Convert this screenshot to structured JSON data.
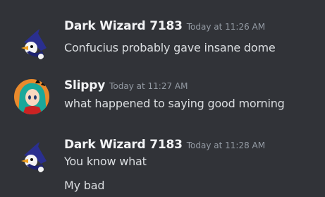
{
  "messages": [
    {
      "author": "Dark Wizard 7183",
      "timestamp": "Today at 11:26 AM",
      "avatar_icon": "wizard-avatar-icon",
      "lines": [
        "Confucius probably gave insane dome"
      ]
    },
    {
      "author": "Slippy",
      "timestamp": "Today at 11:27 AM",
      "avatar_icon": "anime-girl-avatar-icon",
      "lines": [
        "what happened to saying good morning"
      ]
    },
    {
      "author": "Dark Wizard 7183",
      "timestamp": "Today at 11:28 AM",
      "avatar_icon": "wizard-avatar-icon",
      "lines": [
        "You know what",
        "My bad"
      ]
    }
  ],
  "colors": {
    "background": "#313338",
    "username": "#f2f3f5",
    "timestamp": "#949ba4",
    "text": "#dbdee1"
  }
}
